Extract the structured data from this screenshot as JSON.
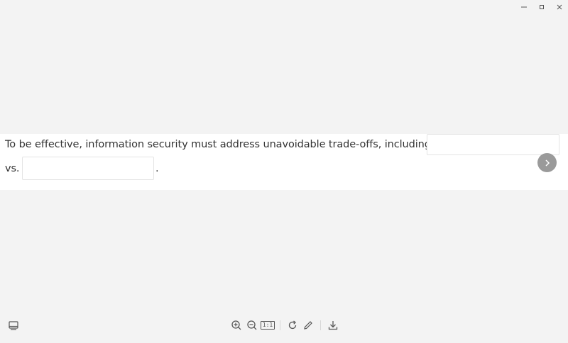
{
  "window": {
    "controls": [
      "minimize",
      "maximize",
      "close"
    ]
  },
  "question": {
    "line1": "To be effective, information security must address unavoidable trade-offs, including",
    "line2_prefix": "vs.",
    "line2_suffix": ".",
    "blank1_value": "",
    "blank2_value": ""
  },
  "navigation": {
    "next_icon": "chevron-right-icon"
  },
  "toolbar": {
    "left_icon": "panel-icon",
    "zoom_reset_label": "1:1",
    "icons": [
      "zoom-in-icon",
      "zoom-out-icon",
      "zoom-reset-icon",
      "rotate-icon",
      "edit-icon",
      "download-icon"
    ]
  },
  "colors": {
    "background": "#f3f3f3",
    "content_bg": "#ffffff",
    "text": "#333333",
    "next_button": "#9a9a9a"
  }
}
